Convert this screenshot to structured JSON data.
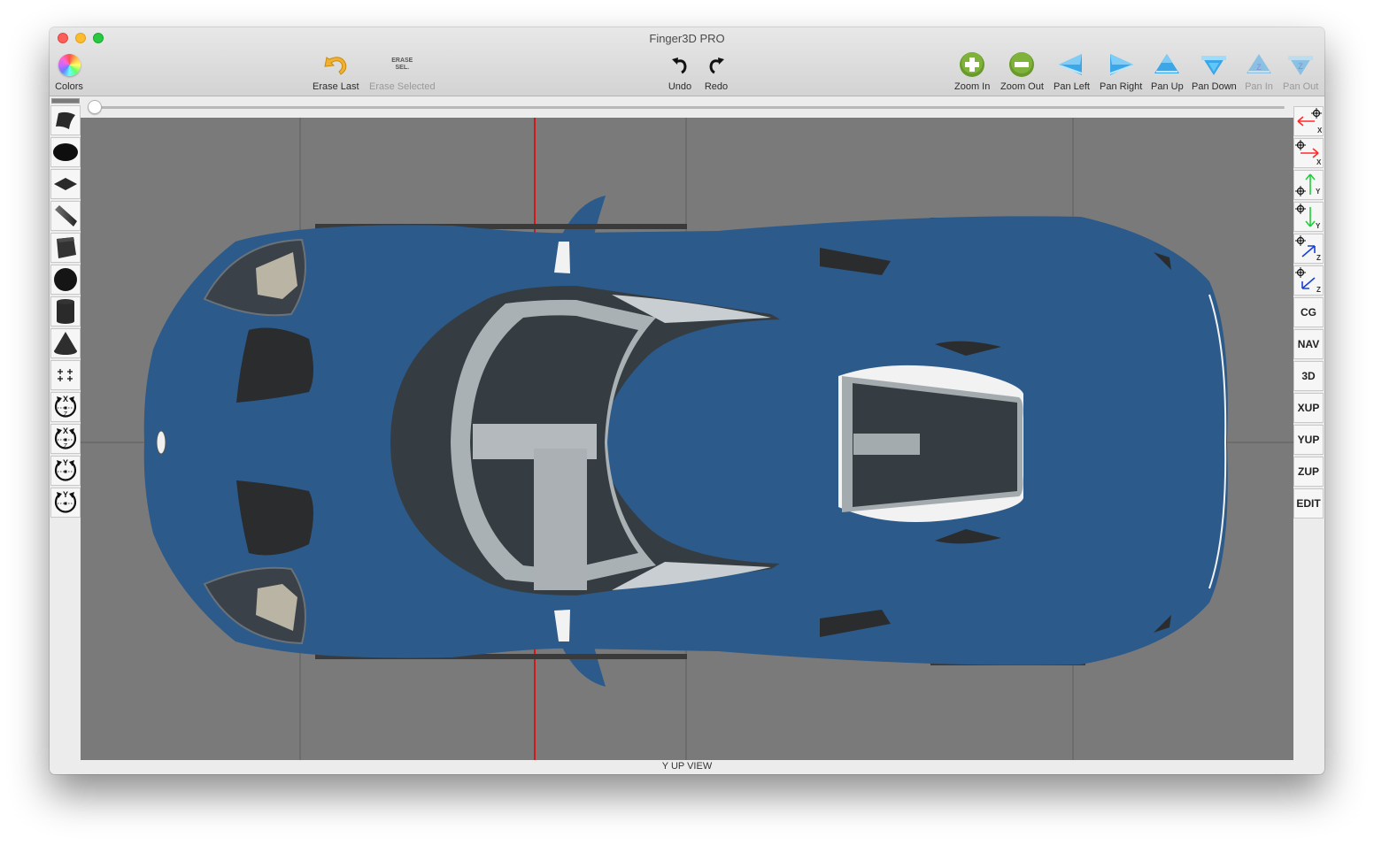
{
  "window": {
    "title": "Finger3D PRO"
  },
  "toolbar": {
    "colors": {
      "label": "Colors",
      "icon": "color-wheel-icon"
    },
    "erase_last": {
      "label": "Erase Last",
      "icon": "undo-arrow-icon"
    },
    "erase_selected": {
      "label": "Erase Selected",
      "icon_text_1": "ERASE",
      "icon_text_2": "SEL.",
      "disabled": true
    },
    "undo": {
      "label": "Undo"
    },
    "redo": {
      "label": "Redo"
    },
    "zoom_in": {
      "label": "Zoom In"
    },
    "zoom_out": {
      "label": "Zoom Out"
    },
    "pan_left": {
      "label": "Pan Left"
    },
    "pan_right": {
      "label": "Pan Right"
    },
    "pan_up": {
      "label": "Pan Up"
    },
    "pan_down": {
      "label": "Pan Down"
    },
    "pan_in": {
      "label": "Pan In",
      "glyph": "Z",
      "disabled": true
    },
    "pan_out": {
      "label": "Pan Out",
      "glyph": "Z",
      "disabled": true
    }
  },
  "slider": {
    "value": 0
  },
  "left_tools": [
    {
      "name": "curved-surface"
    },
    {
      "name": "ellipse"
    },
    {
      "name": "plane"
    },
    {
      "name": "extrusion"
    },
    {
      "name": "cube"
    },
    {
      "name": "sphere"
    },
    {
      "name": "cylinder"
    },
    {
      "name": "cone"
    },
    {
      "name": "points"
    },
    {
      "name": "rotate-xz-ccw",
      "top": "X",
      "mid": "Z"
    },
    {
      "name": "rotate-xz-cw",
      "top": "X",
      "mid": "Z"
    },
    {
      "name": "rotate-y-ccw",
      "top": "Y"
    },
    {
      "name": "rotate-y-cw",
      "top": "Y"
    }
  ],
  "right_tools": {
    "axis_buttons": [
      {
        "name": "move-neg-x",
        "axis": "X",
        "color": "#ff2a2a"
      },
      {
        "name": "move-pos-x",
        "axis": "X",
        "color": "#ff2a2a"
      },
      {
        "name": "move-pos-y",
        "axis": "Y",
        "color": "#1ecf3a"
      },
      {
        "name": "move-neg-y",
        "axis": "Y",
        "color": "#1ecf3a"
      },
      {
        "name": "move-pos-z",
        "axis": "Z",
        "color": "#1a3fd8"
      },
      {
        "name": "move-neg-z",
        "axis": "Z",
        "color": "#1a3fd8"
      }
    ],
    "text_buttons": [
      "CG",
      "NAV",
      "3D",
      "XUP",
      "YUP",
      "ZUP",
      "EDIT"
    ]
  },
  "viewport": {
    "view_label": "Y UP VIEW",
    "background": "#7a7a7a",
    "model_color": "#2c5a8a",
    "axis_line_color": "#d01a1a"
  }
}
